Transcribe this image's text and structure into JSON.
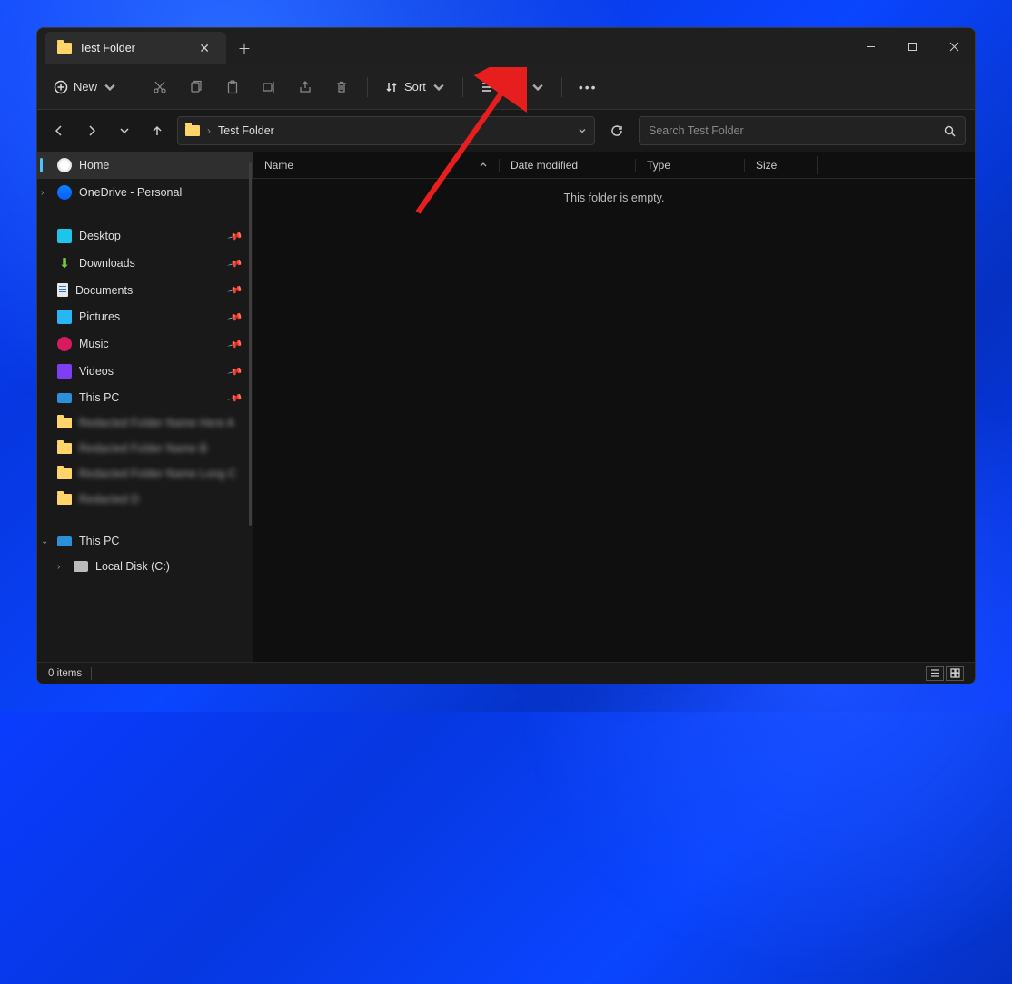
{
  "tab": {
    "title": "Test Folder"
  },
  "toolbar": {
    "new_label": "New",
    "sort_label": "Sort",
    "view_label": "View"
  },
  "breadcrumb": {
    "folder_name": "Test Folder"
  },
  "search": {
    "placeholder": "Search Test Folder"
  },
  "sidebar": {
    "home": "Home",
    "onedrive": "OneDrive - Personal",
    "desktop": "Desktop",
    "downloads": "Downloads",
    "documents": "Documents",
    "pictures": "Pictures",
    "music": "Music",
    "videos": "Videos",
    "thispc": "This PC",
    "thispc2": "This PC",
    "localdisk": "Local Disk (C:)"
  },
  "columns": {
    "name": "Name",
    "date": "Date modified",
    "type": "Type",
    "size": "Size"
  },
  "content": {
    "empty_message": "This folder is empty."
  },
  "status": {
    "item_count": "0 items"
  }
}
